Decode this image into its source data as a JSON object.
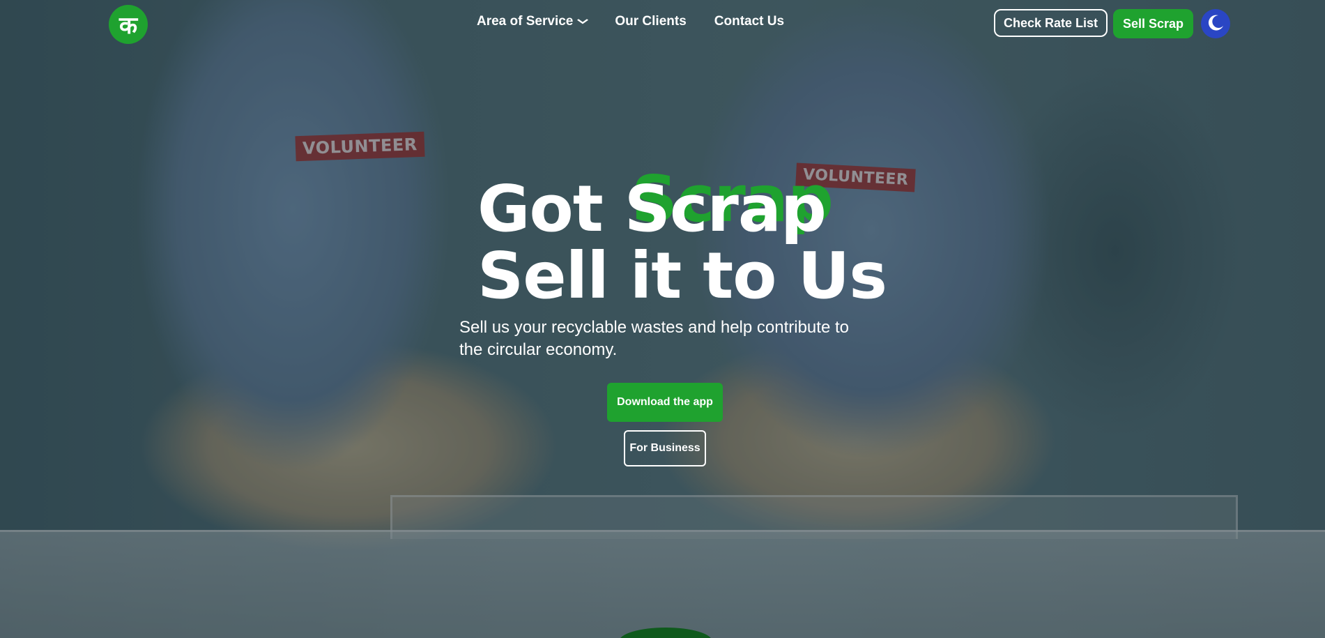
{
  "header": {
    "logo_glyph": "क",
    "nav": [
      {
        "label": "Area of Service",
        "has_dropdown": true
      },
      {
        "label": "Our Clients"
      },
      {
        "label": "Contact Us"
      }
    ],
    "check_rate_label": "Check Rate List",
    "sell_scrap_label": "Sell Scrap",
    "theme_toggle_icon": "moon-icon"
  },
  "background": {
    "patch_left": "VOLUNTEER",
    "patch_right": "VOLUNTEER"
  },
  "hero": {
    "headline_line1_a": "Got ",
    "headline_line1_b": "Scrap",
    "headline_line2": "Sell it to Us",
    "subtext": "Sell us your recyclable wastes and help contribute to the circular economy.",
    "download_label": "Download the app",
    "business_label": "For Business"
  },
  "colors": {
    "brand_green": "#1fa22f",
    "toggle_blue": "#2a46c4"
  }
}
